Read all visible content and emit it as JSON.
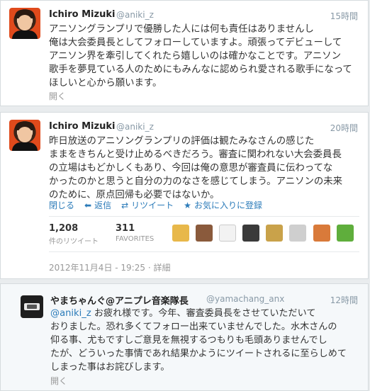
{
  "tweet1": {
    "name": "Ichiro Mizuki",
    "handle": "@aniki_z",
    "time": "15時間",
    "lines": [
      "アニソングランプリで優勝した人には何も責任はありませんし",
      "俺は大会委員長としてフォローしていますよ。頑張ってデビューして",
      "アニソン界を牽引してくれたら嬉しいのは確かなことです。アニソン",
      "歌手を夢見ている人のためにもみんなに認められ愛される歌手になって",
      "ほしいと心から願います。"
    ],
    "open_label": "開く"
  },
  "tweet2": {
    "name": "Ichiro Mizuki",
    "handle": "@aniki_z",
    "time": "20時間",
    "lines": [
      "昨日放送のアニソングランプリの評価は観たみなさんの感じた",
      "ままをきちんと受け止めるべきだろう。審査に関われない大会委員長",
      "の立場はもどかしくもあり、今回は俺の意思が審査員に伝わってな",
      "かったのかと思うと自分の力のなさを感じてしまう。アニソンの未来",
      "のために、原点回帰も必要ではないか。"
    ],
    "actions": {
      "close": "閉じる",
      "reply": "返信",
      "retweet": "リツイート",
      "favorite": "お気に入りに登録"
    },
    "retweets": {
      "count": "1,208",
      "label": "件のリツイート"
    },
    "favorites": {
      "count": "311",
      "label": "FAVORITES"
    },
    "timestamp": "2012年11月4日 - 19:25",
    "detail_label": "詳細",
    "favoriter_icons": [
      "avatar-1",
      "avatar-2",
      "avatar-3",
      "avatar-4",
      "avatar-5",
      "avatar-6",
      "avatar-7",
      "avatar-8"
    ]
  },
  "reply": {
    "name": "やまちゃんぐ@アニプレ音楽隊長",
    "handle": "@yamachang_anx",
    "time": "12時間",
    "mention": "@aniki_z",
    "first_line_rest": " お疲れ様です。今年、審査委員長をさせていただいて",
    "lines": [
      "おりました。恐れ多くてフォロー出来ていませんでした。水木さんの",
      "仰る事、尤もですしご意見を無視するつもりも毛頭ありませんでし",
      "たが、どういった事情であれ結果かようにツイートされるに至らしめて",
      "しまった事はお詫びします。"
    ],
    "open_label": "開く"
  },
  "colors": {
    "link": "#2b7bb9",
    "muted": "#8899a6",
    "accent": "#e04a1c"
  }
}
